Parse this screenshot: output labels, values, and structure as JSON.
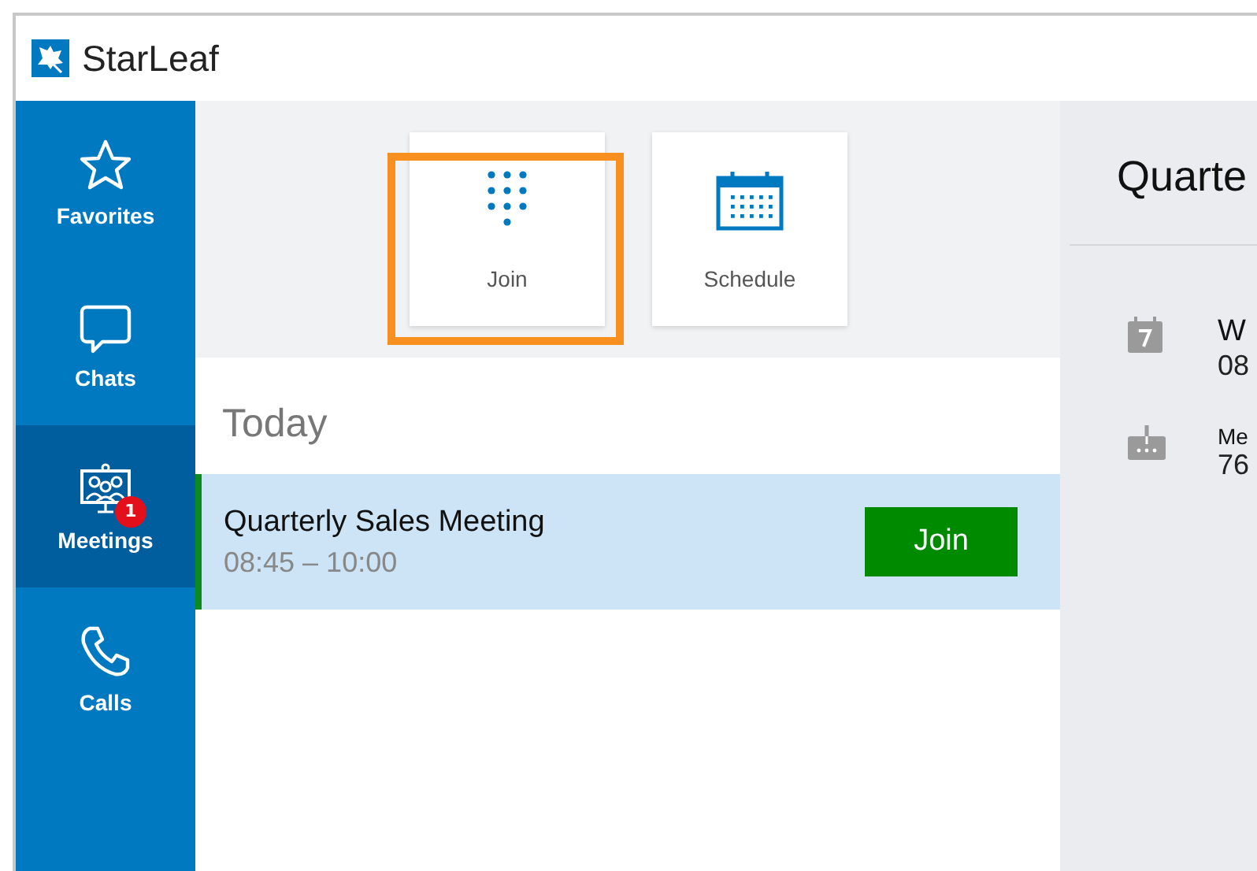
{
  "window": {
    "title": "StarLeaf"
  },
  "sidebar": {
    "items": [
      {
        "label": "Favorites",
        "kind": "star",
        "selected": false
      },
      {
        "label": "Chats",
        "kind": "chat",
        "selected": false
      },
      {
        "label": "Meetings",
        "kind": "meetings",
        "selected": true,
        "badge": "1"
      },
      {
        "label": "Calls",
        "kind": "phone",
        "selected": false
      }
    ]
  },
  "actions": [
    {
      "label": "Join",
      "kind": "dialpad",
      "highlighted": true
    },
    {
      "label": "Schedule",
      "kind": "calendar",
      "highlighted": false
    }
  ],
  "meetings": {
    "heading": "Today",
    "rows": [
      {
        "title": "Quarterly Sales Meeting",
        "time": "08:45 – 10:00",
        "selected": true,
        "button": "Join"
      }
    ]
  },
  "detail": {
    "title": "Quarte",
    "rows": [
      {
        "kind": "date",
        "line_1": "W",
        "line_2": "08"
      },
      {
        "kind": "dialin",
        "line_1": "Me",
        "line_2": "76"
      }
    ]
  }
}
